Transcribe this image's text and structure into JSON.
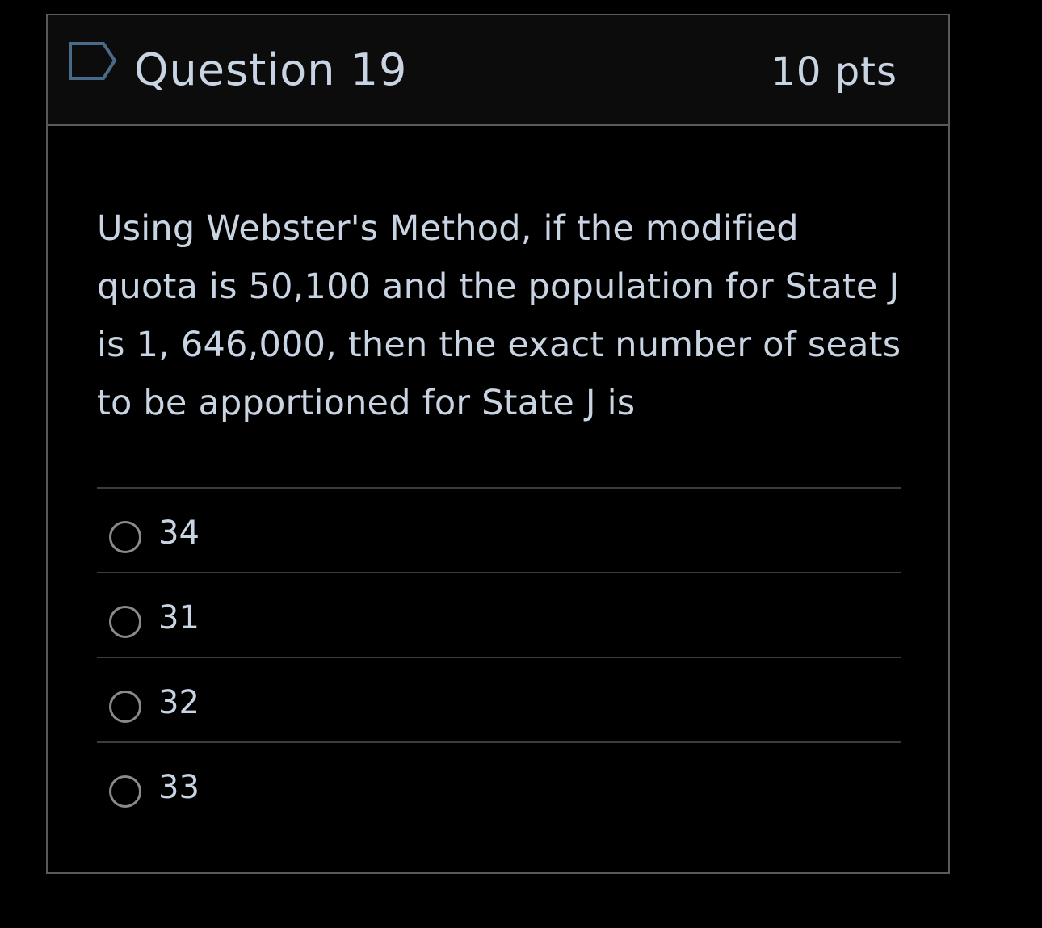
{
  "question": {
    "title": "Question 19",
    "points": "10 pts",
    "flag_icon": "flag-bookmark-icon",
    "text": "Using Webster's Method, if the modified quota is 50,100 and the population for State J is 1, 646,000, then the exact number of seats to be apportioned for State J is"
  },
  "answers": [
    {
      "label": "34",
      "selected": false
    },
    {
      "label": "31",
      "selected": false
    },
    {
      "label": "32",
      "selected": false
    },
    {
      "label": "33",
      "selected": false
    }
  ],
  "colors": {
    "background": "#000000",
    "header_background": "#0c0c0c",
    "border": "#5a5a5a",
    "text": "#c9d4e3",
    "icon": "#4a6a8a",
    "radio_border": "#8a8a8a"
  }
}
